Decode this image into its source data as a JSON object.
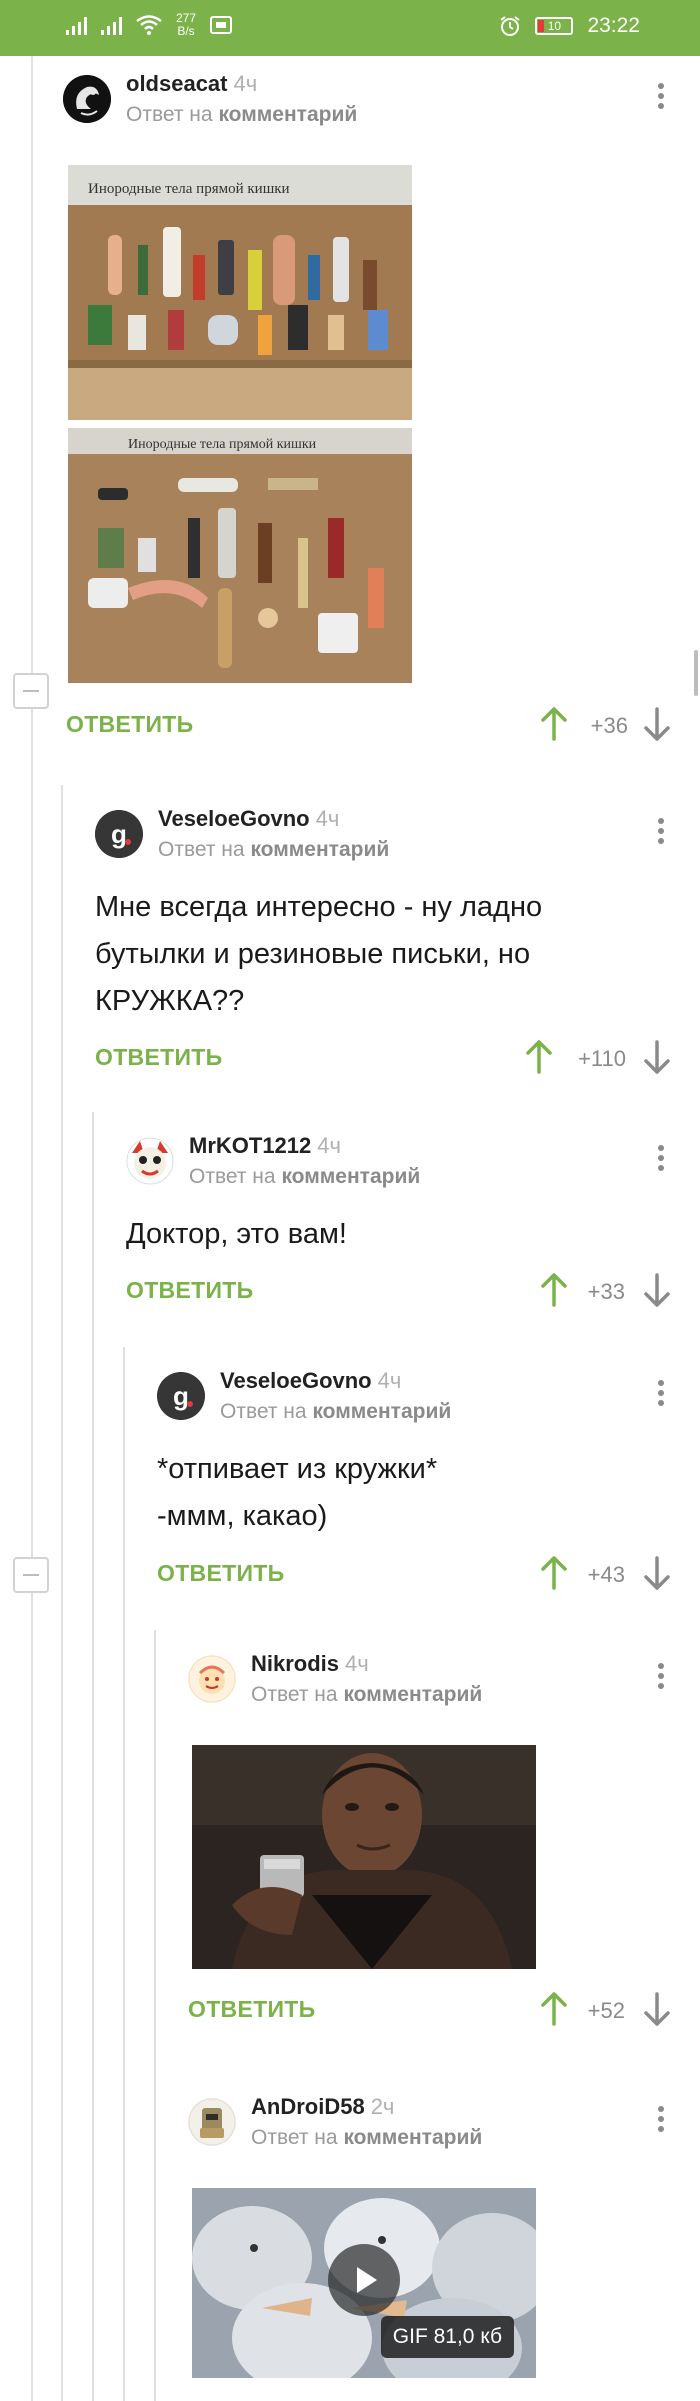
{
  "status_bar": {
    "speed_value": "277",
    "speed_unit": "B/s",
    "battery": "10",
    "time": "23:22"
  },
  "reply_label": "ОТВЕТИТЬ",
  "reply_to_prefix": "Ответ на",
  "reply_to_link": "комментарий",
  "comments": [
    {
      "username": "oldseacat",
      "time": "4ч",
      "text": "",
      "score": "+36",
      "image_caption": "Инородные тела прямой кишки"
    },
    {
      "username": "VeseloeGovno",
      "time": "4ч",
      "text_lines": [
        "Мне всегда интересно - ну ладно",
        "бутылки и резиновые письки, но",
        "КРУЖКА??"
      ],
      "score": "+110"
    },
    {
      "username": "MrKOT1212",
      "time": "4ч",
      "text": "Доктор, это вам!",
      "score": "+33"
    },
    {
      "username": "VeseloeGovno",
      "time": "4ч",
      "text_lines": [
        "*отпивает из кружки*",
        "-ммм, какао)"
      ],
      "score": "+43"
    },
    {
      "username": "Nikrodis",
      "time": "4ч",
      "score": "+52"
    },
    {
      "username": "AnDroiD58",
      "time": "2ч",
      "gif_label": "GIF 81,0 кб"
    }
  ],
  "colors": {
    "accent": "#7bb24a",
    "status_bar": "#7bb24a",
    "muted": "#8a8a8a"
  }
}
